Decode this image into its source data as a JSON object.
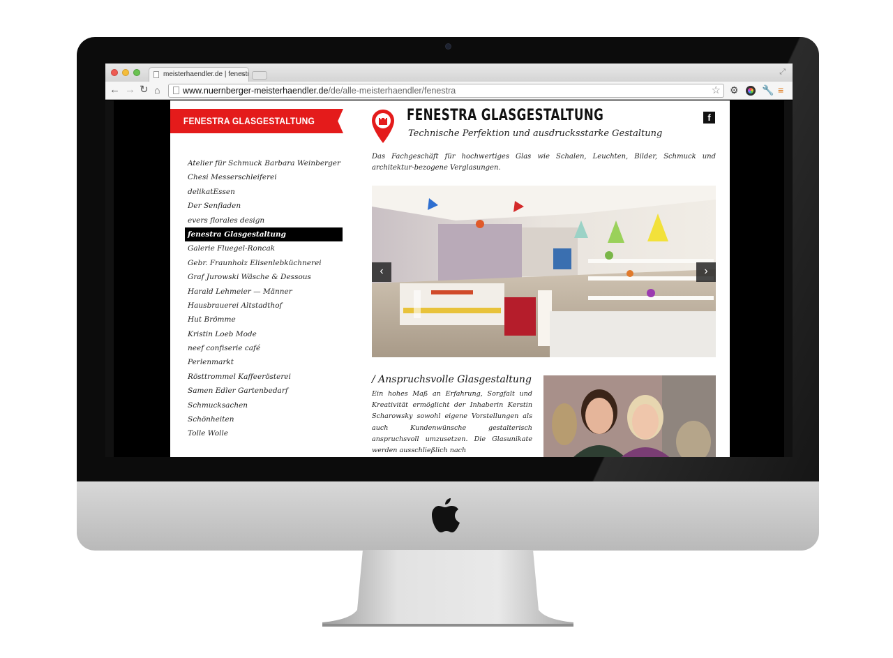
{
  "browser": {
    "tab_title": "meisterhaendler.de | fenestra Glasgestaltung",
    "tab_close": "×",
    "url_host": "www.nuernberger-meisterhaendler.de",
    "url_path": "/de/alle-meisterhaendler/fenestra"
  },
  "sidebar": {
    "banner": "FENESTRA GLASGESTALTUNG",
    "items": [
      {
        "label": "Atelier für Schmuck Barbara Weinberger"
      },
      {
        "label": "Chesi Messerschleiferei"
      },
      {
        "label": "delikatEssen"
      },
      {
        "label": "Der Senfladen"
      },
      {
        "label": "evers florales design"
      },
      {
        "label": "fenestra Glasgestaltung",
        "active": true
      },
      {
        "label": "Galerie Fluegel-Roncak"
      },
      {
        "label": "Gebr. Fraunholz Elisenlebküchnerei"
      },
      {
        "label": "Graf Jurowski Wäsche & Dessous"
      },
      {
        "label": "Harald Lehmeier — Männer"
      },
      {
        "label": "Hausbrauerei Altstadthof"
      },
      {
        "label": "Hut Brömme"
      },
      {
        "label": "Kristin Loeb Mode"
      },
      {
        "label": "neef confiserie café"
      },
      {
        "label": "Perlenmarkt"
      },
      {
        "label": "Rösttrommel Kaffeerösterei"
      },
      {
        "label": "Samen Edler Gartenbedarf"
      },
      {
        "label": "Schmucksachen"
      },
      {
        "label": "Schönheiten"
      },
      {
        "label": "Tolle Wolle"
      }
    ]
  },
  "main": {
    "title": "FENESTRA GLASGESTALTUNG",
    "subtitle": "Technische Perfektion und ausdrucksstarke Gestaltung",
    "facebook": "f",
    "intro": "Das Fachgeschäft für hochwertiges Glas wie Schalen, Leuchten, Bilder, Schmuck und architektur-bezogene Verglasungen.",
    "slider": {
      "prev": "‹",
      "next": "›"
    },
    "section_title": "/ Anspruchsvolle Glasgestaltung",
    "section_body": "Ein hohes Maß an Erfahrung, Sorgfalt und Kreativität ermöglicht der Inhaberin Kerstin Scharowsky sowohl eigene Vorstellungen als auch Kundenwünsche gestalterisch anspruchsvoll umzusetzen. Die Glasunikate werden ausschließlich nach"
  },
  "colors": {
    "accent_red": "#e41b1b",
    "active_item_bg": "#000000",
    "page_bg": "#ffffff"
  },
  "icons": [
    "back-icon",
    "forward-icon",
    "reload-icon",
    "home-icon",
    "star-icon",
    "gear-icon",
    "color-icon",
    "wrench-icon",
    "menu-icon",
    "facebook-icon",
    "location-pin-icon",
    "apple-logo-icon"
  ]
}
